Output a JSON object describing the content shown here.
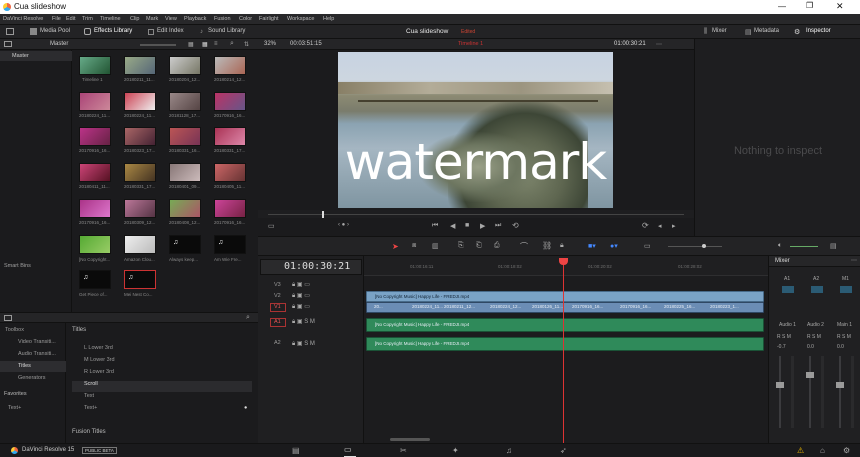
{
  "window": {
    "title": "Cua slideshow"
  },
  "menu": [
    "DaVinci Resolve",
    "File",
    "Edit",
    "Trim",
    "Timeline",
    "Clip",
    "Mark",
    "View",
    "Playback",
    "Fusion",
    "Color",
    "Fairlight",
    "Workspace",
    "Help"
  ],
  "toolbar": {
    "media_pool": "Media Pool",
    "effects_library": "Effects Library",
    "edit_index": "Edit Index",
    "sound_library": "Sound Library",
    "project_title": "Cua slideshow",
    "edited": "Edited",
    "mixer": "Mixer",
    "metadata": "Metadata",
    "inspector": "Inspector"
  },
  "viewer_bar": {
    "zoom": "32%",
    "duration": "00:03:51:15",
    "timeline_name": "Timeline 1",
    "timecode": "01:00:30:21"
  },
  "media_pool": {
    "bin": "Master",
    "sidebar_master": "Master",
    "smart_bins": "Smart Bins",
    "clips": [
      "Timeline 1",
      "20180211_11...",
      "20180204_12...",
      "20180214_12...",
      "20180224_11...",
      "20180224_11...",
      "20181128_17...",
      "20170916_16...",
      "20170916_16...",
      "20180323_17...",
      "20180331_16...",
      "20180331_17...",
      "20180411_11...",
      "20180331_17...",
      "20180401_09...",
      "20180405_11...",
      "20170916_16...",
      "20180309_12...",
      "20180408_12...",
      "20170916_16...",
      "[No Copyright...",
      "Amazon Clou...",
      "Always keep...",
      "Am Wie Fre...",
      "Get Piece of...",
      "Mei Nest Co..."
    ]
  },
  "effects": {
    "tree": {
      "toolbox": "Toolbox",
      "video_transitions": "Video Transiti...",
      "audio_transitions": "Audio Transiti...",
      "titles": "Titles",
      "generators": "Generators"
    },
    "favorites": "Favorites",
    "favorites_item": "Text+",
    "section_titles": "Titles",
    "items": [
      "L Lower 3rd",
      "M Lower 3rd",
      "R Lower 3rd",
      "Scroll",
      "Text",
      "Text+"
    ],
    "section_fusion": "Fusion Titles"
  },
  "viewer": {
    "watermark": "watermark"
  },
  "inspector": {
    "empty": "Nothing to inspect"
  },
  "timeline": {
    "timecode": "01:00:30:21",
    "ruler": [
      "01:00:16:11",
      "01:00:18:02",
      "01:00:20:02",
      "01:00:28:02"
    ],
    "tracks": {
      "v3": "V3",
      "v2": "V2",
      "v1": "V1",
      "a1": "A1",
      "a2": "A2"
    },
    "v2_clip": "[No Copyright Music] Happy Life - FREDJI.mp4",
    "v1_clips": [
      "20...",
      "20180224_11...",
      "20180211_12...",
      "20180224_12...",
      "20180126_11...",
      "20170916_16...",
      "20170916_16...",
      "20180225_16...",
      "20180223_1..."
    ],
    "a1_clip": "[No Copyright Music] Happy Life - FREDJI.mp4",
    "a2_clip": "[No Copyright Music] Happy Life - FREDJI.mp4"
  },
  "mixer": {
    "title": "Mixer",
    "channels": [
      "A1",
      "A2",
      "M1"
    ],
    "strips": [
      "Audio 1",
      "Audio 2",
      "Main 1"
    ],
    "levels": [
      "-0.7",
      "0.0",
      "0.0"
    ]
  },
  "bottom": {
    "app": "DaVinci Resolve 15",
    "badge": "PUBLIC BETA"
  }
}
